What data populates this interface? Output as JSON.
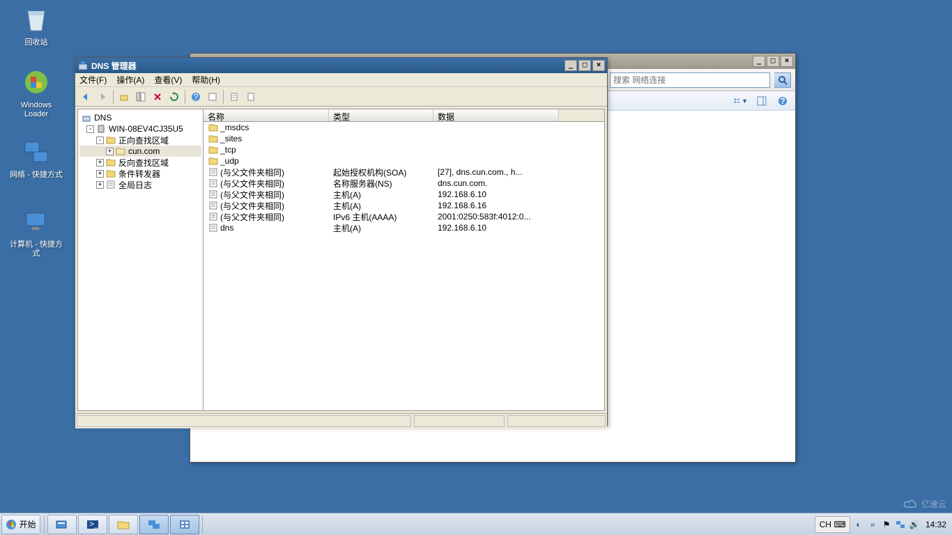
{
  "desktop": {
    "icons": [
      {
        "label": "回收站"
      },
      {
        "label": "Windows Loader"
      },
      {
        "label": "网络 - 快捷方式"
      },
      {
        "label": "计算机 - 快捷方式"
      }
    ]
  },
  "back_window": {
    "search_placeholder": "搜索 网络连接"
  },
  "dns_window": {
    "title": "DNS 管理器",
    "menu": {
      "file": "文件(F)",
      "action": "操作(A)",
      "view": "查看(V)",
      "help": "帮助(H)"
    },
    "tree": {
      "root": "DNS",
      "server": "WIN-08EV4CJ35U5",
      "forward": "正向查找区域",
      "zone": "cun.com",
      "reverse": "反向查找区域",
      "forwarder": "条件转发器",
      "global_log": "全局日志"
    },
    "columns": {
      "name": "名称",
      "type": "类型",
      "data": "数据"
    },
    "folders": [
      "_msdcs",
      "_sites",
      "_tcp",
      "_udp"
    ],
    "records": [
      {
        "name": "(与父文件夹相同)",
        "type": "起始授权机构(SOA)",
        "data": "[27], dns.cun.com., h..."
      },
      {
        "name": "(与父文件夹相同)",
        "type": "名称服务器(NS)",
        "data": "dns.cun.com."
      },
      {
        "name": "(与父文件夹相同)",
        "type": "主机(A)",
        "data": "192.168.6.10"
      },
      {
        "name": "(与父文件夹相同)",
        "type": "主机(A)",
        "data": "192.168.6.16"
      },
      {
        "name": "(与父文件夹相同)",
        "type": "IPv6 主机(AAAA)",
        "data": "2001:0250:583f:4012:0..."
      },
      {
        "name": "dns",
        "type": "主机(A)",
        "data": "192.168.6.10"
      }
    ]
  },
  "taskbar": {
    "start": "开始",
    "lang": "CH",
    "time": "14:32"
  },
  "watermark": "亿速云"
}
